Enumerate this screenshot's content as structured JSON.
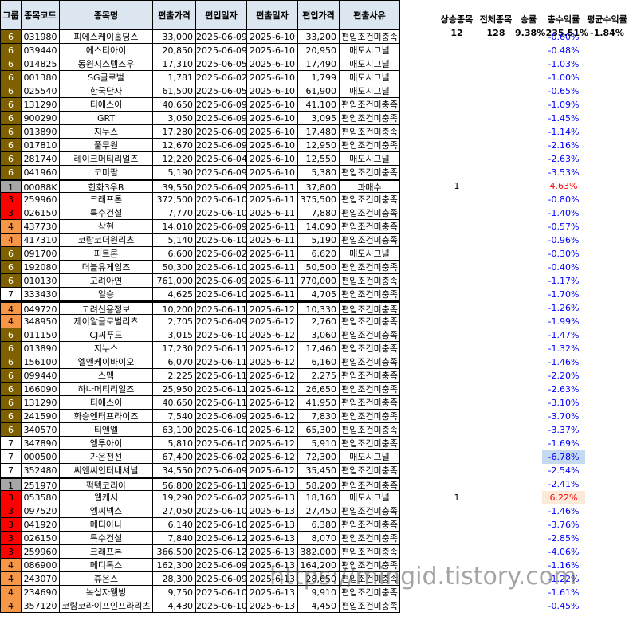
{
  "headers": [
    "그룹",
    "종목코드",
    "종목명",
    "편출가격",
    "편입일자",
    "편출일자",
    "편입가격",
    "편출사유"
  ],
  "summary": {
    "headers": [
      "상승종목",
      "전체종목",
      "승률",
      "총수익률",
      "평균수익률"
    ],
    "values": [
      "12",
      "128",
      "9.38%",
      "-235.51%",
      "-1.84%"
    ]
  },
  "rows": [
    {
      "g": "6",
      "code": "031980",
      "name": "피에스케이홀딩스",
      "out_price": "33,000",
      "in_date": "2025-06-09",
      "out_date": "2025-6-10",
      "in_price": "33,200",
      "reason": "편입조건미충족",
      "up": "",
      "ret": "-0.60%"
    },
    {
      "g": "6",
      "code": "039440",
      "name": "에스티아이",
      "out_price": "20,850",
      "in_date": "2025-06-09",
      "out_date": "2025-6-10",
      "in_price": "20,950",
      "reason": "매도시그널",
      "up": "",
      "ret": "-0.48%"
    },
    {
      "g": "6",
      "code": "014825",
      "name": "동원시스템즈우",
      "out_price": "17,310",
      "in_date": "2025-06-05",
      "out_date": "2025-6-10",
      "in_price": "17,490",
      "reason": "매도시그널",
      "up": "",
      "ret": "-1.03%"
    },
    {
      "g": "6",
      "code": "001380",
      "name": "SG글로벌",
      "out_price": "1,781",
      "in_date": "2025-06-02",
      "out_date": "2025-6-10",
      "in_price": "1,799",
      "reason": "매도시그널",
      "up": "",
      "ret": "-1.00%"
    },
    {
      "g": "6",
      "code": "025540",
      "name": "한국단자",
      "out_price": "61,500",
      "in_date": "2025-06-05",
      "out_date": "2025-6-10",
      "in_price": "61,900",
      "reason": "매도시그널",
      "up": "",
      "ret": "-0.65%"
    },
    {
      "g": "6",
      "code": "131290",
      "name": "티에스이",
      "out_price": "40,650",
      "in_date": "2025-06-09",
      "out_date": "2025-6-10",
      "in_price": "41,100",
      "reason": "편입조건미충족",
      "up": "",
      "ret": "-1.09%"
    },
    {
      "g": "6",
      "code": "900290",
      "name": "GRT",
      "out_price": "3,050",
      "in_date": "2025-06-09",
      "out_date": "2025-6-10",
      "in_price": "3,095",
      "reason": "편입조건미충족",
      "up": "",
      "ret": "-1.45%"
    },
    {
      "g": "6",
      "code": "013890",
      "name": "지누스",
      "out_price": "17,280",
      "in_date": "2025-06-09",
      "out_date": "2025-6-10",
      "in_price": "17,480",
      "reason": "편입조건미충족",
      "up": "",
      "ret": "-1.14%"
    },
    {
      "g": "6",
      "code": "017810",
      "name": "풀무원",
      "out_price": "12,670",
      "in_date": "2025-06-09",
      "out_date": "2025-6-10",
      "in_price": "12,950",
      "reason": "편입조건미충족",
      "up": "",
      "ret": "-2.16%"
    },
    {
      "g": "6",
      "code": "281740",
      "name": "레이크머티리얼즈",
      "out_price": "12,220",
      "in_date": "2025-06-04",
      "out_date": "2025-6-10",
      "in_price": "12,550",
      "reason": "매도시그널",
      "up": "",
      "ret": "-2.63%"
    },
    {
      "g": "6",
      "code": "041960",
      "name": "코미팜",
      "out_price": "5,190",
      "in_date": "2025-06-09",
      "out_date": "2025-6-10",
      "in_price": "5,380",
      "reason": "편입조건미충족",
      "up": "",
      "ret": "-3.53%"
    },
    {
      "g": "1",
      "code": "00088K",
      "name": "한화3우B",
      "out_price": "39,550",
      "in_date": "2025-06-09",
      "out_date": "2025-6-11",
      "in_price": "37,800",
      "reason": "과매수",
      "up": "1",
      "ret": "4.63%",
      "sep": true
    },
    {
      "g": "3",
      "code": "259960",
      "name": "크래프톤",
      "out_price": "372,500",
      "in_date": "2025-06-10",
      "out_date": "2025-6-11",
      "in_price": "375,500",
      "reason": "편입조건미충족",
      "up": "",
      "ret": "-0.80%"
    },
    {
      "g": "3",
      "code": "026150",
      "name": "특수건설",
      "out_price": "7,770",
      "in_date": "2025-06-10",
      "out_date": "2025-6-11",
      "in_price": "7,880",
      "reason": "편입조건미충족",
      "up": "",
      "ret": "-1.40%"
    },
    {
      "g": "4",
      "code": "437730",
      "name": "삼현",
      "out_price": "14,010",
      "in_date": "2025-06-09",
      "out_date": "2025-6-11",
      "in_price": "14,090",
      "reason": "편입조건미충족",
      "up": "",
      "ret": "-0.57%"
    },
    {
      "g": "4",
      "code": "417310",
      "name": "코람코더원리츠",
      "out_price": "5,140",
      "in_date": "2025-06-10",
      "out_date": "2025-6-11",
      "in_price": "5,190",
      "reason": "편입조건미충족",
      "up": "",
      "ret": "-0.96%"
    },
    {
      "g": "6",
      "code": "091700",
      "name": "파트론",
      "out_price": "6,600",
      "in_date": "2025-06-02",
      "out_date": "2025-6-11",
      "in_price": "6,620",
      "reason": "매도시그널",
      "up": "",
      "ret": "-0.30%"
    },
    {
      "g": "6",
      "code": "192080",
      "name": "더블유게임즈",
      "out_price": "50,300",
      "in_date": "2025-06-10",
      "out_date": "2025-6-11",
      "in_price": "50,500",
      "reason": "편입조건미충족",
      "up": "",
      "ret": "-0.40%"
    },
    {
      "g": "6",
      "code": "010130",
      "name": "고려아연",
      "out_price": "761,000",
      "in_date": "2025-06-09",
      "out_date": "2025-6-11",
      "in_price": "770,000",
      "reason": "편입조건미충족",
      "up": "",
      "ret": "-1.17%"
    },
    {
      "g": "7",
      "code": "333430",
      "name": "일승",
      "out_price": "4,625",
      "in_date": "2025-06-10",
      "out_date": "2025-6-11",
      "in_price": "4,705",
      "reason": "편입조건미충족",
      "up": "",
      "ret": "-1.70%"
    },
    {
      "g": "4",
      "code": "049720",
      "name": "고려신용정보",
      "out_price": "10,200",
      "in_date": "2025-06-11",
      "out_date": "2025-6-12",
      "in_price": "10,330",
      "reason": "편입조건미충족",
      "up": "",
      "ret": "-1.26%",
      "sep": true
    },
    {
      "g": "4",
      "code": "348950",
      "name": "제이알글로벌리츠",
      "out_price": "2,705",
      "in_date": "2025-06-09",
      "out_date": "2025-6-12",
      "in_price": "2,760",
      "reason": "편입조건미충족",
      "up": "",
      "ret": "-1.99%"
    },
    {
      "g": "6",
      "code": "011150",
      "name": "CJ씨푸드",
      "out_price": "3,015",
      "in_date": "2025-06-10",
      "out_date": "2025-6-12",
      "in_price": "3,060",
      "reason": "편입조건미충족",
      "up": "",
      "ret": "-1.47%"
    },
    {
      "g": "6",
      "code": "013890",
      "name": "지누스",
      "out_price": "17,230",
      "in_date": "2025-06-11",
      "out_date": "2025-6-12",
      "in_price": "17,460",
      "reason": "편입조건미충족",
      "up": "",
      "ret": "-1.32%"
    },
    {
      "g": "6",
      "code": "156100",
      "name": "엘앤케이바이오",
      "out_price": "6,070",
      "in_date": "2025-06-11",
      "out_date": "2025-6-12",
      "in_price": "6,160",
      "reason": "편입조건미충족",
      "up": "",
      "ret": "-1.46%"
    },
    {
      "g": "6",
      "code": "099440",
      "name": "스맥",
      "out_price": "2,225",
      "in_date": "2025-06-11",
      "out_date": "2025-6-12",
      "in_price": "2,275",
      "reason": "편입조건미충족",
      "up": "",
      "ret": "-2.20%"
    },
    {
      "g": "6",
      "code": "166090",
      "name": "하나머티리얼즈",
      "out_price": "25,950",
      "in_date": "2025-06-11",
      "out_date": "2025-6-12",
      "in_price": "26,650",
      "reason": "편입조건미충족",
      "up": "",
      "ret": "-2.63%"
    },
    {
      "g": "6",
      "code": "131290",
      "name": "티에스이",
      "out_price": "40,650",
      "in_date": "2025-06-11",
      "out_date": "2025-6-12",
      "in_price": "41,950",
      "reason": "편입조건미충족",
      "up": "",
      "ret": "-3.10%"
    },
    {
      "g": "6",
      "code": "241590",
      "name": "화승엔터프라이즈",
      "out_price": "7,540",
      "in_date": "2025-06-09",
      "out_date": "2025-6-12",
      "in_price": "7,830",
      "reason": "편입조건미충족",
      "up": "",
      "ret": "-3.70%"
    },
    {
      "g": "6",
      "code": "340570",
      "name": "티앤엘",
      "out_price": "63,100",
      "in_date": "2025-06-10",
      "out_date": "2025-6-12",
      "in_price": "65,300",
      "reason": "편입조건미충족",
      "up": "",
      "ret": "-3.37%"
    },
    {
      "g": "7",
      "code": "347890",
      "name": "엠투아이",
      "out_price": "5,810",
      "in_date": "2025-06-10",
      "out_date": "2025-6-12",
      "in_price": "5,910",
      "reason": "편입조건미충족",
      "up": "",
      "ret": "-1.69%"
    },
    {
      "g": "7",
      "code": "000500",
      "name": "가온전선",
      "out_price": "67,400",
      "in_date": "2025-06-02",
      "out_date": "2025-6-12",
      "in_price": "72,300",
      "reason": "매도시그널",
      "up": "",
      "ret": "-6.78%",
      "hl": "blue"
    },
    {
      "g": "7",
      "code": "352480",
      "name": "씨앤씨인터내셔널",
      "out_price": "34,550",
      "in_date": "2025-06-09",
      "out_date": "2025-6-12",
      "in_price": "35,450",
      "reason": "편입조건미충족",
      "up": "",
      "ret": "-2.54%"
    },
    {
      "g": "1",
      "code": "251970",
      "name": "펌텍코리아",
      "out_price": "56,800",
      "in_date": "2025-06-11",
      "out_date": "2025-6-13",
      "in_price": "58,200",
      "reason": "편입조건미충족",
      "up": "",
      "ret": "-2.41%",
      "sep": true
    },
    {
      "g": "3",
      "code": "053580",
      "name": "웹케시",
      "out_price": "19,290",
      "in_date": "2025-06-02",
      "out_date": "2025-6-13",
      "in_price": "18,160",
      "reason": "매도시그널",
      "up": "1",
      "ret": "6.22%",
      "hl": "orange"
    },
    {
      "g": "3",
      "code": "097520",
      "name": "엠씨넥스",
      "out_price": "27,050",
      "in_date": "2025-06-10",
      "out_date": "2025-6-13",
      "in_price": "27,450",
      "reason": "편입조건미충족",
      "up": "",
      "ret": "-1.46%"
    },
    {
      "g": "3",
      "code": "041920",
      "name": "메디아나",
      "out_price": "6,140",
      "in_date": "2025-06-10",
      "out_date": "2025-6-13",
      "in_price": "6,380",
      "reason": "편입조건미충족",
      "up": "",
      "ret": "-3.76%"
    },
    {
      "g": "3",
      "code": "026150",
      "name": "특수건설",
      "out_price": "7,840",
      "in_date": "2025-06-12",
      "out_date": "2025-6-13",
      "in_price": "8,070",
      "reason": "편입조건미충족",
      "up": "",
      "ret": "-2.85%"
    },
    {
      "g": "3",
      "code": "259960",
      "name": "크래프톤",
      "out_price": "366,500",
      "in_date": "2025-06-12",
      "out_date": "2025-6-13",
      "in_price": "382,000",
      "reason": "편입조건미충족",
      "up": "",
      "ret": "-4.06%"
    },
    {
      "g": "4",
      "code": "086900",
      "name": "메디톡스",
      "out_price": "162,300",
      "in_date": "2025-06-09",
      "out_date": "2025-6-13",
      "in_price": "164,200",
      "reason": "편입조건미충족",
      "up": "",
      "ret": "-1.16%"
    },
    {
      "g": "4",
      "code": "243070",
      "name": "휴온스",
      "out_price": "28,300",
      "in_date": "2025-06-09",
      "out_date": "2025-6-13",
      "in_price": "28,650",
      "reason": "편입조건미충족",
      "up": "",
      "ret": "-1.22%"
    },
    {
      "g": "4",
      "code": "234690",
      "name": "녹십자웰빙",
      "out_price": "9,750",
      "in_date": "2025-06-10",
      "out_date": "2025-6-13",
      "in_price": "9,910",
      "reason": "편입조건미충족",
      "up": "",
      "ret": "-1.61%"
    },
    {
      "g": "4",
      "code": "357120",
      "name": "코람코라이프인프라리츠",
      "out_price": "4,430",
      "in_date": "2025-06-10",
      "out_date": "2025-6-13",
      "in_price": "4,450",
      "reason": "편입조건미충족",
      "up": "",
      "ret": "-0.45%"
    }
  ],
  "watermark": "https://mingid.tistory.com"
}
